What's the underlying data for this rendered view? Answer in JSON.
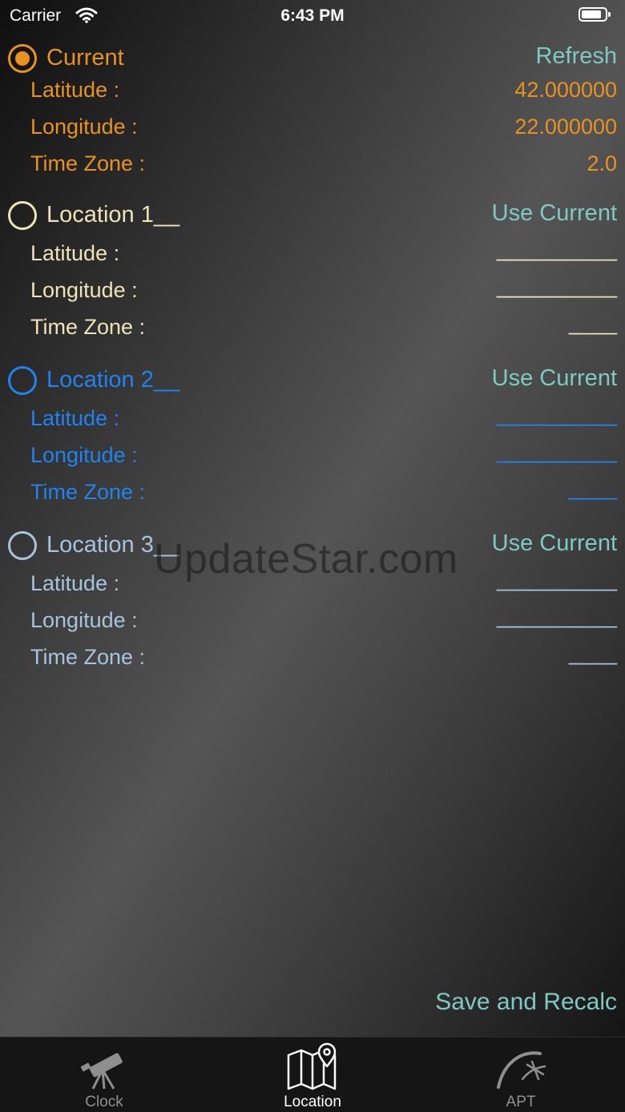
{
  "status_bar": {
    "carrier": "Carrier",
    "time": "6:43 PM"
  },
  "current": {
    "title": "Current",
    "action": "Refresh",
    "selected": true,
    "latitude_label": "Latitude :",
    "latitude_value": "42.000000",
    "longitude_label": "Longitude :",
    "longitude_value": "22.000000",
    "timezone_label": "Time Zone :",
    "timezone_value": "2.0"
  },
  "locations": [
    {
      "title": "Location 1__",
      "action": "Use Current",
      "latitude_label": "Latitude :",
      "latitude_value": "__________",
      "longitude_label": "Longitude :",
      "longitude_value": "__________",
      "timezone_label": "Time Zone :",
      "timezone_value": "____",
      "color": "#efe2b8"
    },
    {
      "title": "Location 2__",
      "action": "Use Current",
      "latitude_label": "Latitude :",
      "latitude_value": "__________",
      "longitude_label": "Longitude :",
      "longitude_value": "__________",
      "timezone_label": "Time Zone :",
      "timezone_value": "____",
      "color": "#1f83f0"
    },
    {
      "title": "Location 3__",
      "action": "Use Current",
      "latitude_label": "Latitude :",
      "latitude_value": "__________",
      "longitude_label": "Longitude :",
      "longitude_value": "__________",
      "timezone_label": "Time Zone :",
      "timezone_value": "____",
      "color": "#a6c4de"
    }
  ],
  "watermark": "UpdateStar.com",
  "save_button": "Save and Recalc",
  "tabs": [
    {
      "label": "Clock",
      "icon": "telescope-icon",
      "active": false
    },
    {
      "label": "Location",
      "icon": "map-pin-icon",
      "active": true
    },
    {
      "label": "APT",
      "icon": "apt-icon",
      "active": false
    }
  ],
  "colors": {
    "accent_current": "#e8921f",
    "action": "#7fc9c3",
    "tab_bar": "#151515"
  }
}
